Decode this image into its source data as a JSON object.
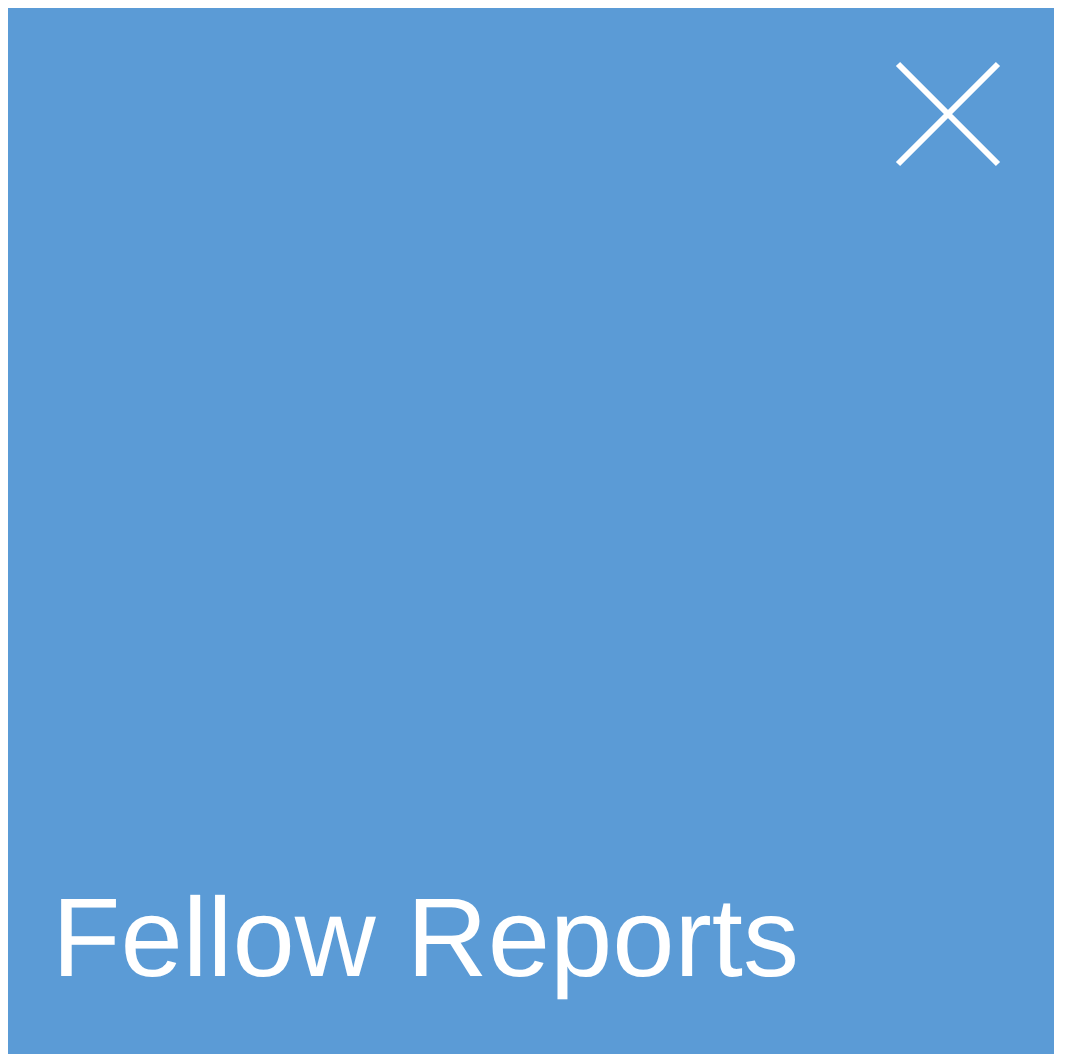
{
  "tile": {
    "title": "Fellow Reports"
  }
}
